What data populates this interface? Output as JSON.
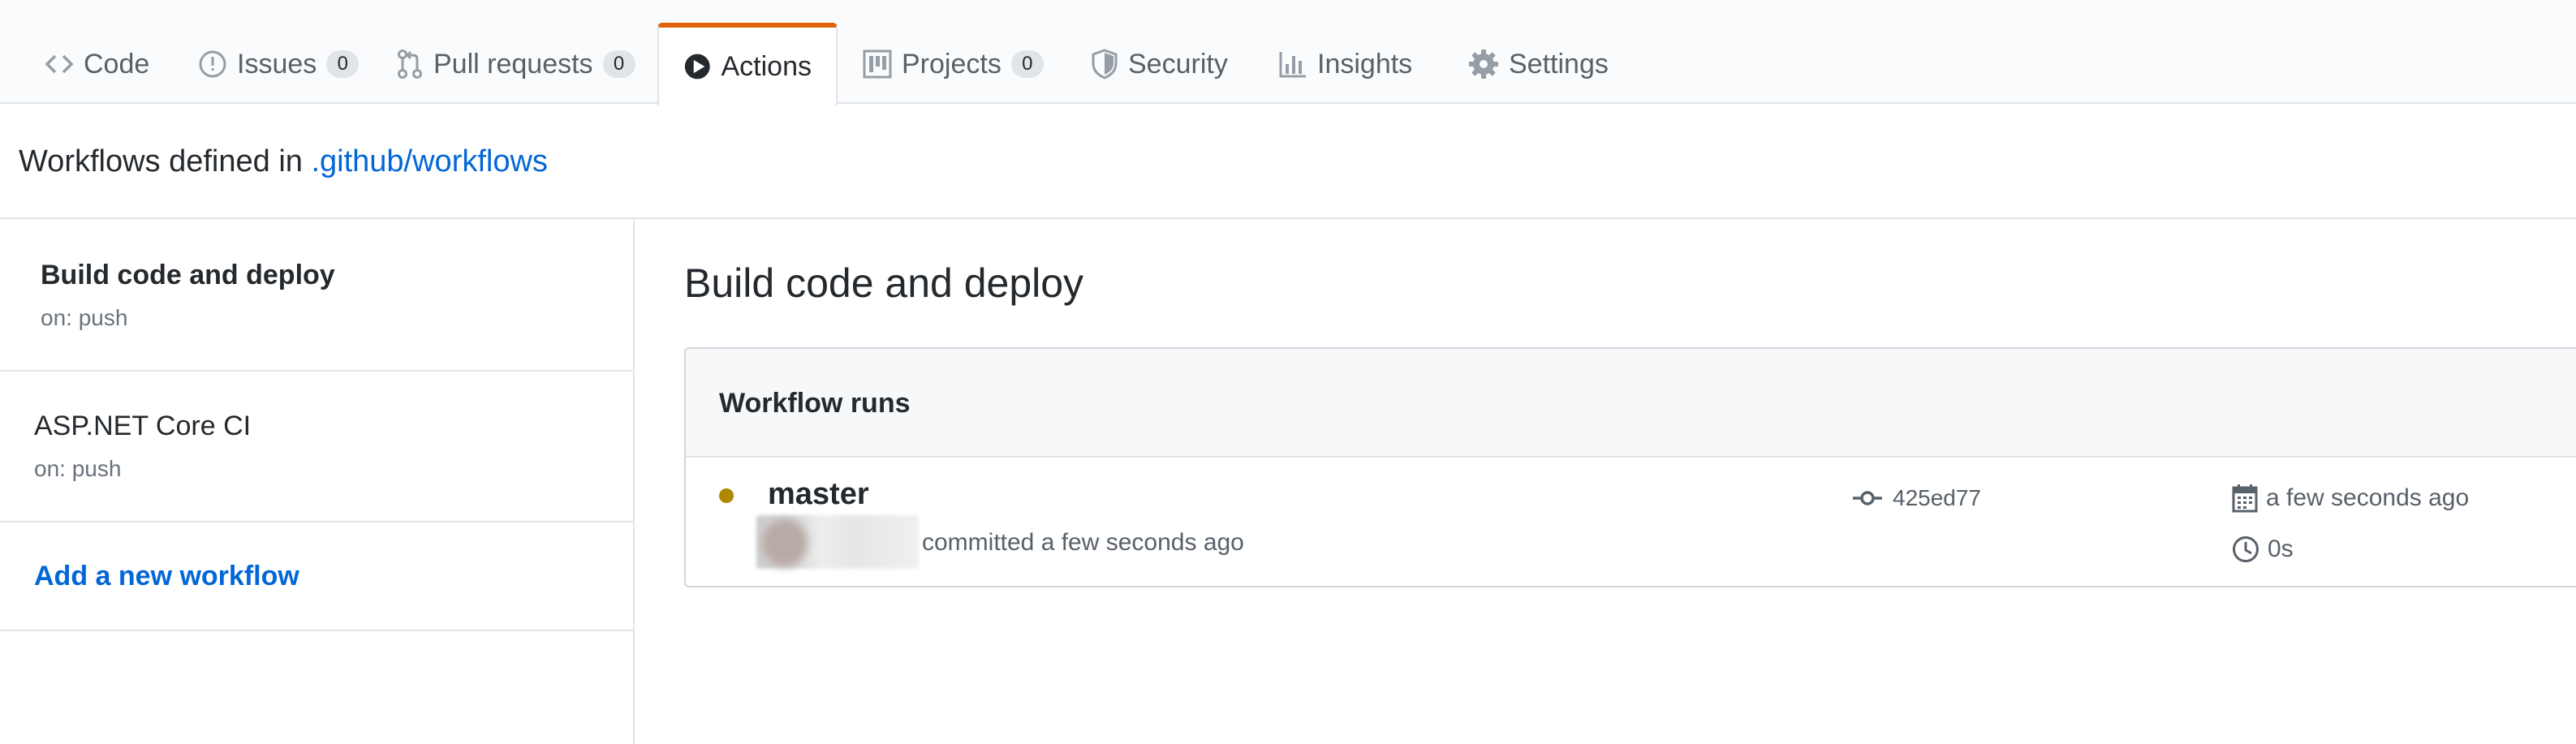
{
  "tabs": [
    {
      "label": "Code",
      "icon": "code-icon"
    },
    {
      "label": "Issues",
      "icon": "issue-icon",
      "count": "0"
    },
    {
      "label": "Pull requests",
      "icon": "pull-request-icon",
      "count": "0"
    },
    {
      "label": "Actions",
      "icon": "play-icon",
      "selected": true
    },
    {
      "label": "Projects",
      "icon": "project-icon",
      "count": "0"
    },
    {
      "label": "Security",
      "icon": "shield-icon"
    },
    {
      "label": "Insights",
      "icon": "graph-icon"
    },
    {
      "label": "Settings",
      "icon": "gear-icon"
    }
  ],
  "workflows_header": {
    "prefix": "Workflows defined in ",
    "path_link": ".github/workflows"
  },
  "sidebar": {
    "items": [
      {
        "title": "Build code and deploy",
        "trigger": "on: push",
        "active": true
      },
      {
        "title": "ASP.NET Core CI",
        "trigger": "on: push"
      }
    ],
    "add_link": "Add a new workflow"
  },
  "main": {
    "title": "Build code and deploy",
    "runs_label": "Workflow runs",
    "run": {
      "branch": "master",
      "committed_text": "committed a few seconds ago",
      "commit_sha": "425ed77",
      "started": "a few seconds ago",
      "duration": "0s",
      "status_color": "#b08800"
    }
  },
  "colors": {
    "accent_tab": "#e36209",
    "link": "#0366d6"
  }
}
